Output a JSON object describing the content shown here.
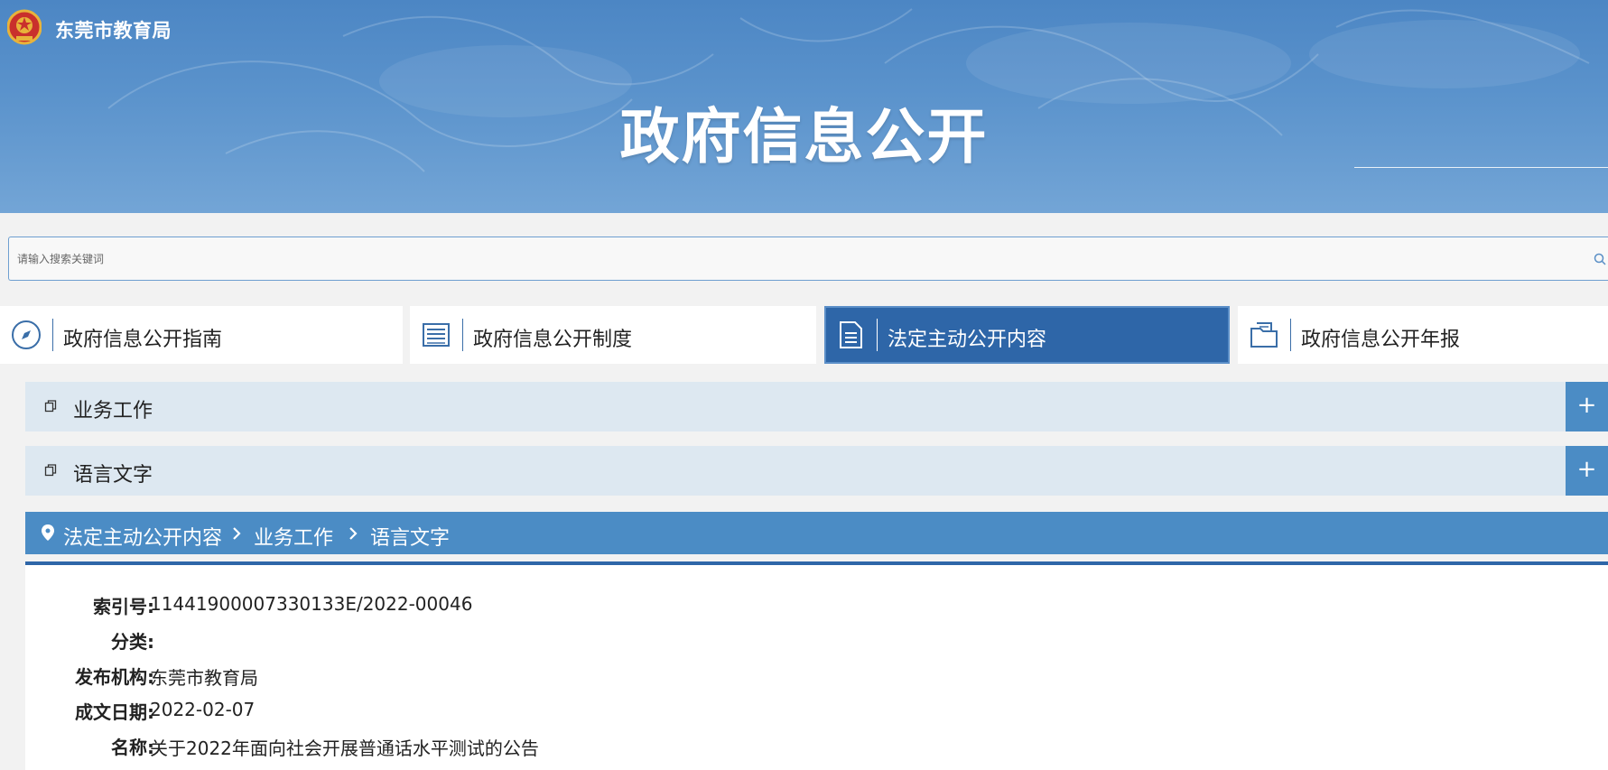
{
  "header": {
    "site_name": "东莞市教育局",
    "page_title": "政府信息公开",
    "logo_icon": "national-emblem-icon"
  },
  "search": {
    "placeholder": "请输入搜索关键词",
    "value": "",
    "icon": "search-icon"
  },
  "tabs": [
    {
      "label": "政府信息公开指南",
      "icon": "compass-icon",
      "active": false
    },
    {
      "label": "政府信息公开制度",
      "icon": "list-icon",
      "active": false
    },
    {
      "label": "法定主动公开内容",
      "icon": "document-icon",
      "active": true
    },
    {
      "label": "政府信息公开年报",
      "icon": "folder-icon",
      "active": false
    }
  ],
  "accordion": [
    {
      "label": "业务工作",
      "expand_symbol": "+"
    },
    {
      "label": "语言文字",
      "expand_symbol": "+"
    }
  ],
  "breadcrumb": [
    "法定主动公开内容",
    "业务工作",
    "语言文字"
  ],
  "details": [
    {
      "label": "索引号:",
      "value": "11441900007330133E/2022-00046"
    },
    {
      "label": "分类:",
      "value": ""
    },
    {
      "label": "发布机构:",
      "value": "东莞市教育局"
    },
    {
      "label": "成文日期:",
      "value": "2022-02-07"
    },
    {
      "label": "名称:",
      "value": "关于2022年面向社会开展普通话水平测试的公告"
    }
  ],
  "colors": {
    "banner": "#5b93cc",
    "active_tab": "#2e66a8",
    "accordion_bg": "#dde8f1",
    "accent": "#4b8cc5"
  }
}
